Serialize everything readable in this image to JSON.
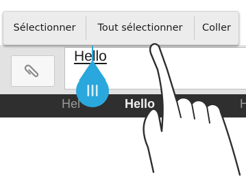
{
  "context_menu": {
    "actions": [
      {
        "label": "Sélectionner"
      },
      {
        "label": "Tout sélectionner"
      },
      {
        "label": "Coller"
      }
    ]
  },
  "composer": {
    "attach_icon": "paperclip-icon",
    "message_text": "Hello"
  },
  "suggestions": [
    "Hel",
    "Hello",
    "H"
  ],
  "colors": {
    "accent": "#2aa7dc",
    "suggestion_bar": "#2f2f2f",
    "action_bar": "#ececec"
  }
}
